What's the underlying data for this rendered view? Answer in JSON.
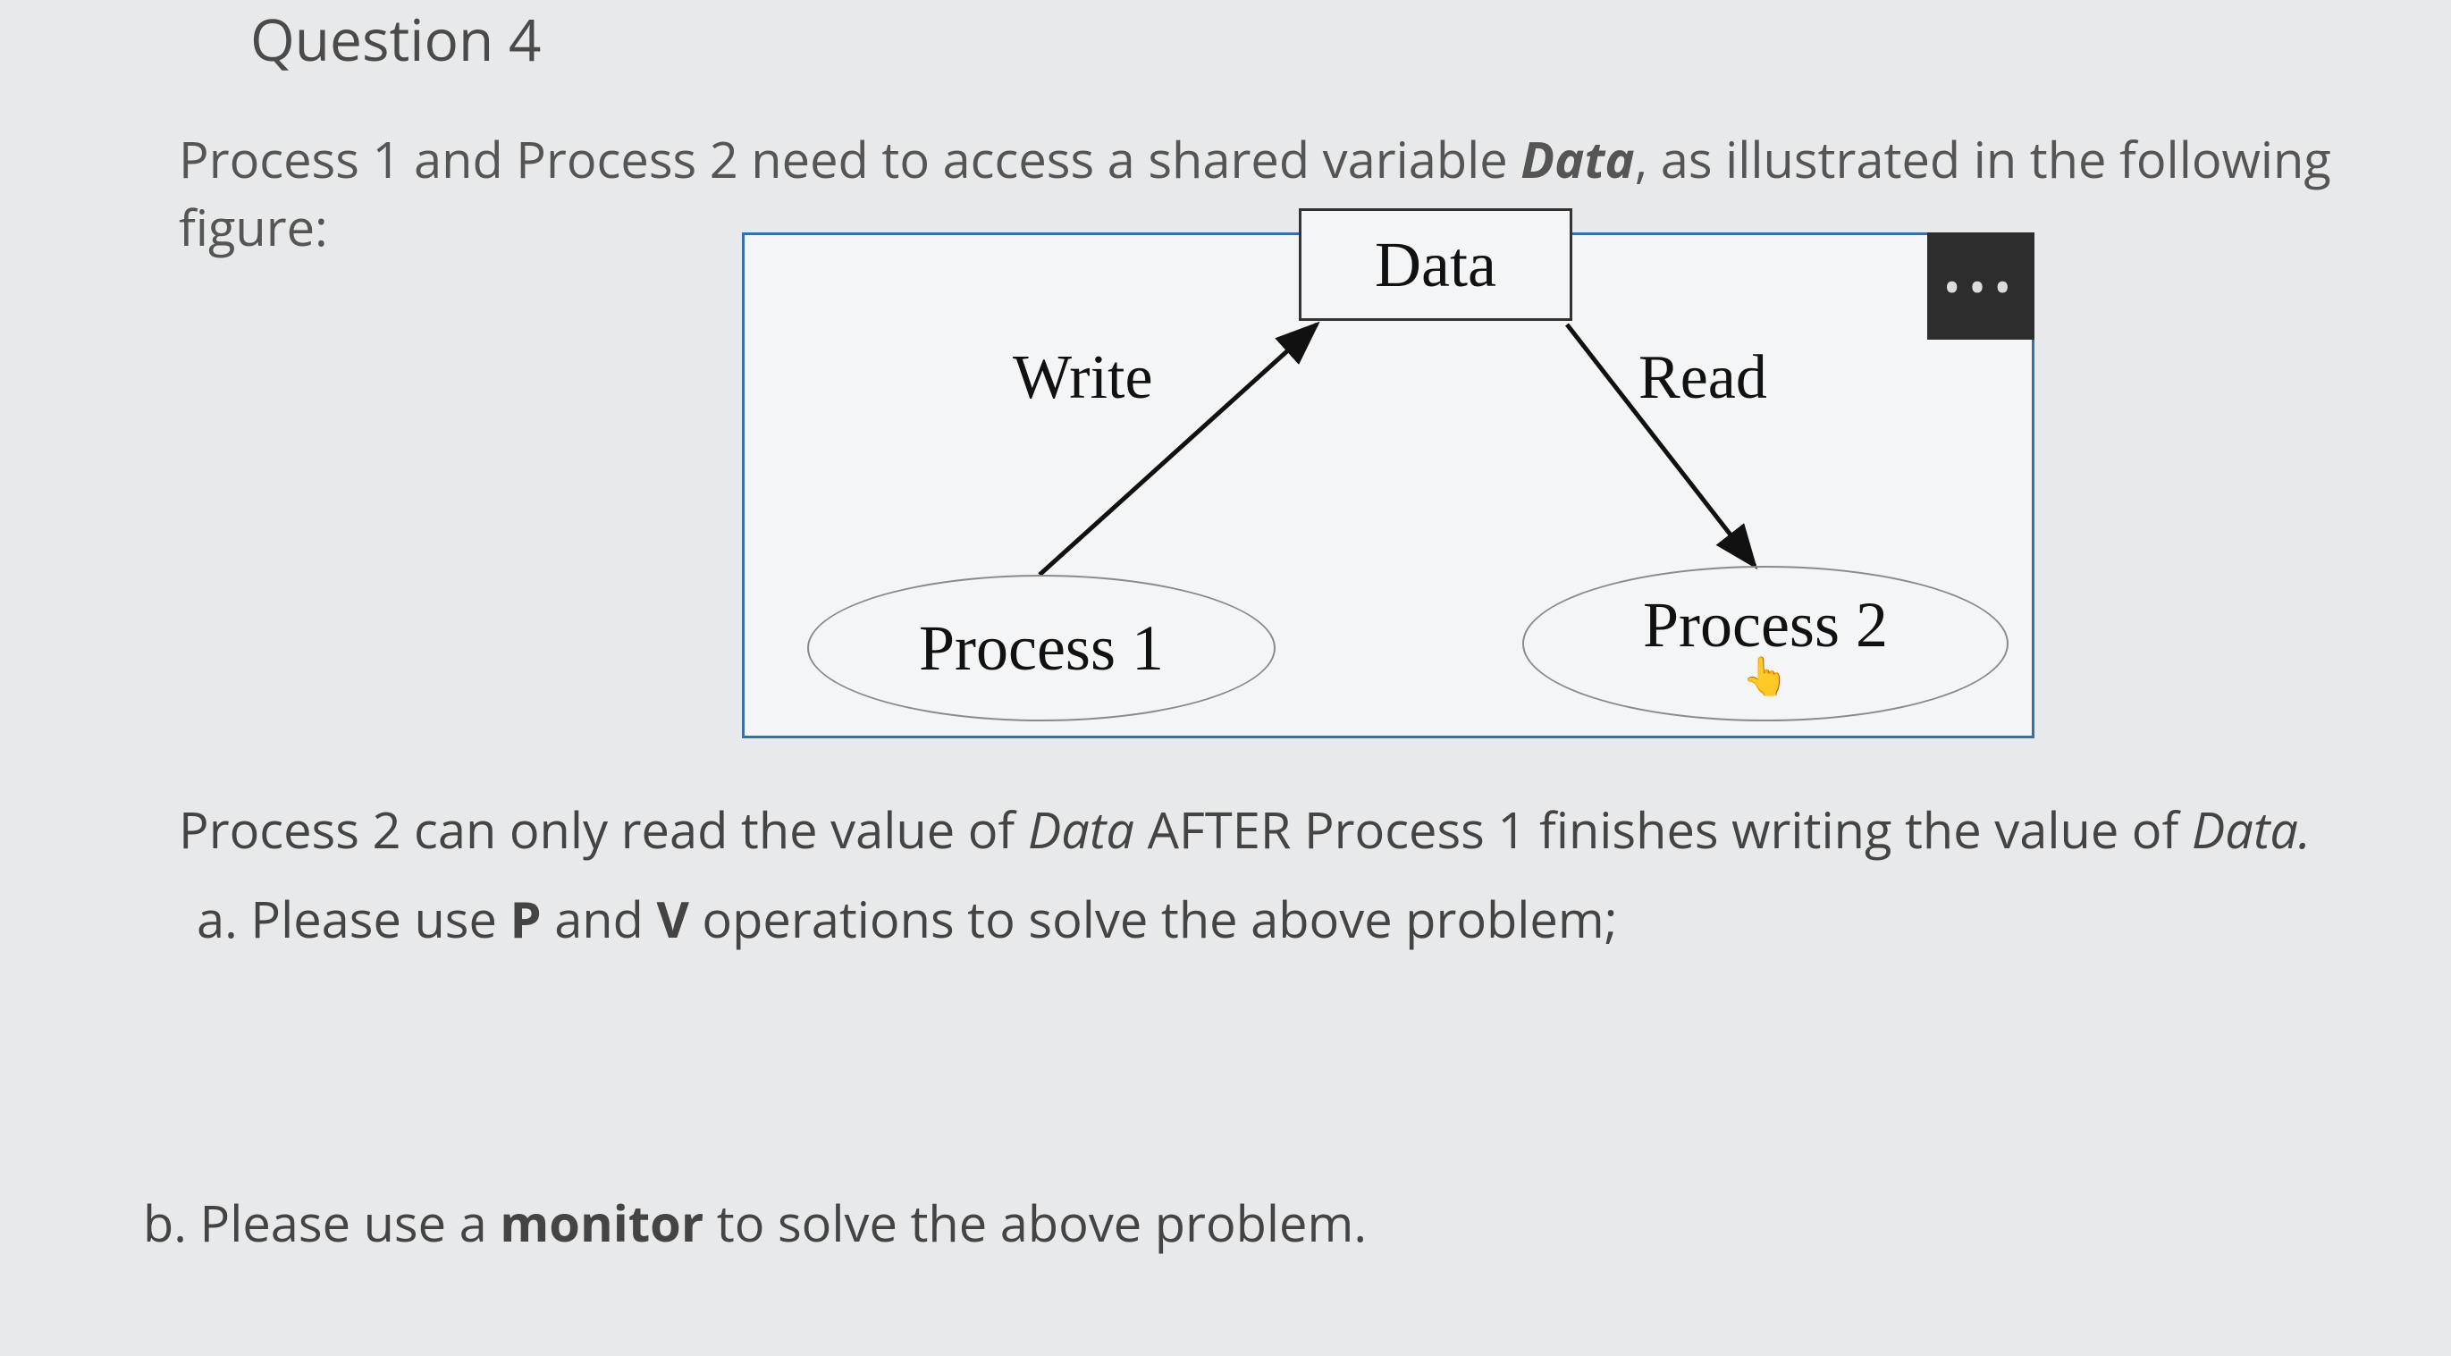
{
  "question_title": "Question 4",
  "intro_pre": "Process 1 and Process 2 need to access a shared variable ",
  "intro_var": "Data",
  "intro_post": ", as illustrated in the following figure:",
  "figure": {
    "data_label": "Data",
    "write_label": "Write",
    "read_label": "Read",
    "process1": "Process  1",
    "process2": "Process  2",
    "overflow": "•••"
  },
  "after_pre": "Process 2 can only read the value of ",
  "after_var1": "Data",
  "after_mid": " AFTER Process 1 finishes writing the value of ",
  "after_var2": "Data.",
  "part_a_pre": "a. Please use ",
  "part_a_p": "P",
  "part_a_and": " and ",
  "part_a_v": "V",
  "part_a_post": " operations to solve the above problem;",
  "part_b_pre": "b. Please use a ",
  "part_b_mon": "monitor",
  "part_b_post": " to solve the above problem."
}
